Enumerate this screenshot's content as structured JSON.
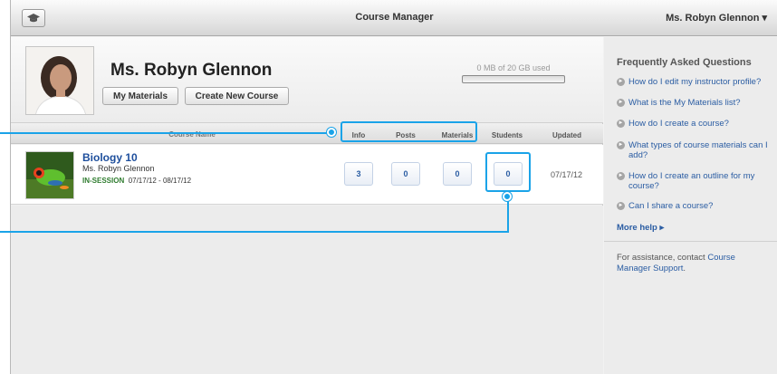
{
  "topbar": {
    "title": "Course Manager",
    "user_menu": "Ms. Robyn Glennon ▾"
  },
  "profile": {
    "name": "Ms. Robyn Glennon",
    "my_materials_label": "My Materials",
    "create_course_label": "Create New Course",
    "storage_text": "0 MB of 20 GB used",
    "storage_used_fraction": 0
  },
  "columns": [
    "Course Name",
    "Info",
    "Posts",
    "Materials",
    "Students",
    "Updated"
  ],
  "course": {
    "name": "Biology 10",
    "instructor": "Ms. Robyn Glennon",
    "status": "IN-SESSION",
    "dates": "07/17/12 - 08/17/12",
    "info": "3",
    "posts": "0",
    "materials": "0",
    "students": "0",
    "updated": "07/17/12"
  },
  "sidebar": {
    "faq_title": "Frequently Asked Questions",
    "faq": [
      "How do I edit my instructor profile?",
      "What is the My Materials list?",
      "How do I create a course?",
      "What types of course materials can I add?",
      "How do I create an outline for my course?",
      "Can I share a course?"
    ],
    "more_help": "More help ▸",
    "assist_prefix": "For assistance, contact ",
    "assist_link": "Course Manager Support",
    "assist_suffix": "."
  },
  "colors": {
    "accent": "#1aa3e8",
    "link": "#2b5da3",
    "status_green": "#2f7c2f"
  },
  "icons": [
    "graduation-cap-icon",
    "dropdown-caret-icon",
    "faq-bullet-icon",
    "chevron-right-icon"
  ]
}
